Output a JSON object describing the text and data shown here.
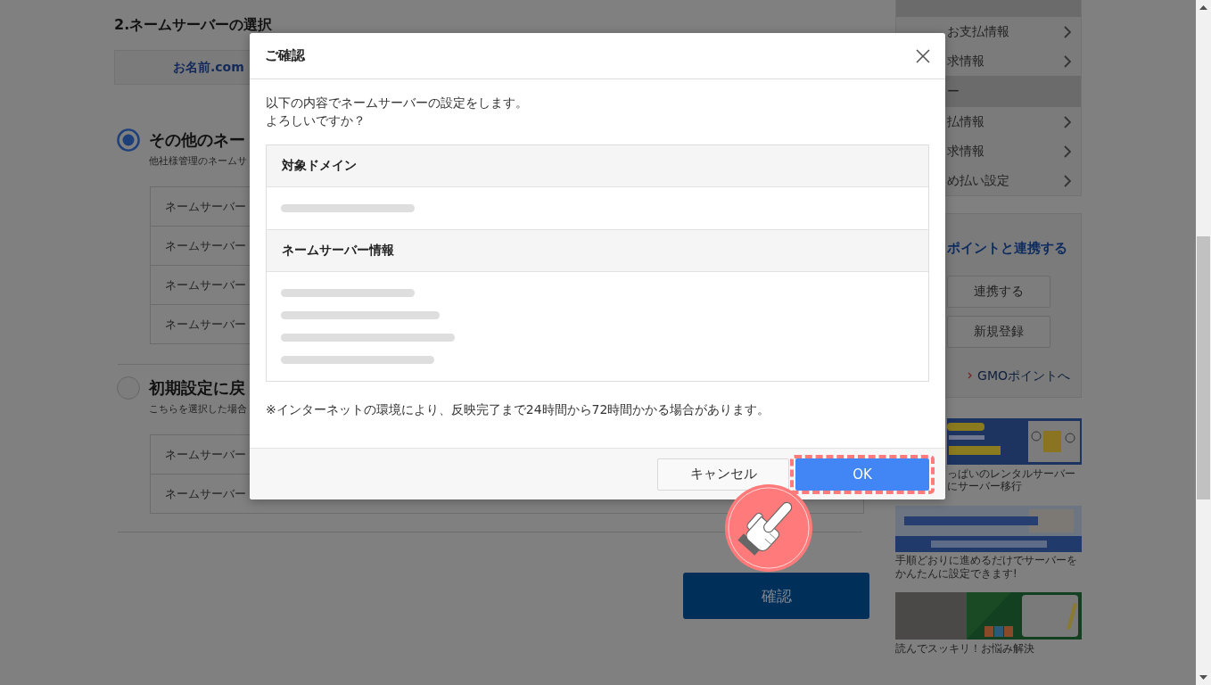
{
  "page": {
    "section_title": "2.ネームサーバーの選択",
    "provider_tab": {
      "label": "お名前.com"
    },
    "options": [
      {
        "label": "その他のネー",
        "description": "他社様管理のネームサ",
        "selected": true,
        "fields": [
          "ネームサーバー",
          "ネームサーバー",
          "ネームサーバー",
          "ネームサーバー"
        ]
      },
      {
        "label": "初期設定に戻",
        "description": "こちらを選択した場合",
        "selected": false,
        "fields": [
          "ネームサーバー",
          "ネームサーバー"
        ]
      }
    ],
    "confirm_button": "確認"
  },
  "sidebar": {
    "menu_sections": [
      {
        "items": [
          "お支払情報",
          "求情報"
        ]
      },
      {
        "heading": "ー",
        "items": [
          "払情報",
          "求情報",
          "め払い設定"
        ]
      }
    ],
    "points_box": {
      "title": "ポイントと連携する",
      "buttons": [
        "連携する",
        "新規登録"
      ],
      "link": "GMOポイントへ"
    },
    "banners": [
      {
        "kind": "moving",
        "caption": [
          "っぱいのレンタルサーバー",
          "にサーバー移行"
        ]
      },
      {
        "kind": "guide",
        "caption": [
          "手順どおりに進めるだけでサーバーをかんたんに設定できます!"
        ]
      },
      {
        "kind": "column",
        "caption": [
          "読んでスッキリ！お悩み解決"
        ]
      }
    ]
  },
  "dialog": {
    "title": "ご確認",
    "message_lines": [
      "以下の内容でネームサーバーの設定をします。",
      "よろしいですか？"
    ],
    "sections": [
      {
        "heading": "対象ドメイン",
        "values": [
          {
            "kind": "blurred"
          }
        ]
      },
      {
        "heading": "ネームサーバー情報",
        "values": [
          {
            "kind": "blurred"
          },
          {
            "kind": "blurred"
          },
          {
            "kind": "blurred"
          },
          {
            "kind": "blurred"
          }
        ]
      }
    ],
    "note": "※インターネットの環境により、反映完了まで24時間から72時間かかる場合があります。",
    "buttons": [
      {
        "label": "キャンセル",
        "kind": "secondary",
        "highlighted": false
      },
      {
        "label": "OK",
        "kind": "primary",
        "highlighted": true
      }
    ]
  },
  "annotation": {
    "kind": "pointing-hand"
  }
}
